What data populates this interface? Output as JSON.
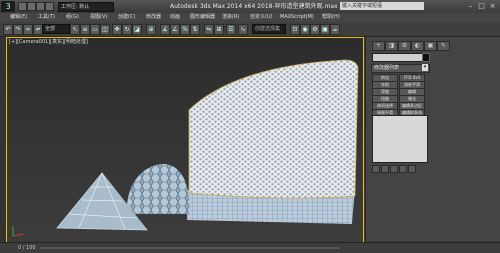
{
  "titlebar": {
    "app_logo": "3",
    "workspace": "工作区: 默认",
    "title": "Autodesk 3ds Max 2014 x64      2018-异形造型建筑外观.max",
    "search_placeholder": "键入关键字或短语"
  },
  "menu": {
    "items": [
      "编辑(E)",
      "工具(T)",
      "组(G)",
      "视图(V)",
      "创建(C)",
      "修改器",
      "动画",
      "图形编辑器",
      "渲染(R)",
      "自定义(U)",
      "MAXScript(M)",
      "帮助(H)"
    ]
  },
  "toolbar": {
    "view_dropdown": "全部",
    "named_selection": "创建选择集"
  },
  "viewport": {
    "label": "[+][Camera001][真实][明暗处理]"
  },
  "cmdpanel": {
    "tabs": [
      "+",
      "◨",
      "⚙",
      "◐",
      "▣",
      "✎"
    ],
    "rollout_title": "修改器列表",
    "modifier_buttons": [
      [
        "挤出",
        "FFD 4x4"
      ],
      [
        "车削",
        "涡轮平滑"
      ],
      [
        "弯曲",
        "编辑"
      ],
      [
        "扭曲",
        "锥化"
      ],
      [
        "体积选择",
        "编辑多边形"
      ],
      [
        "网格平滑",
        "编辑样条线"
      ]
    ]
  },
  "statusbar": {
    "frame": "0 / 100"
  }
}
